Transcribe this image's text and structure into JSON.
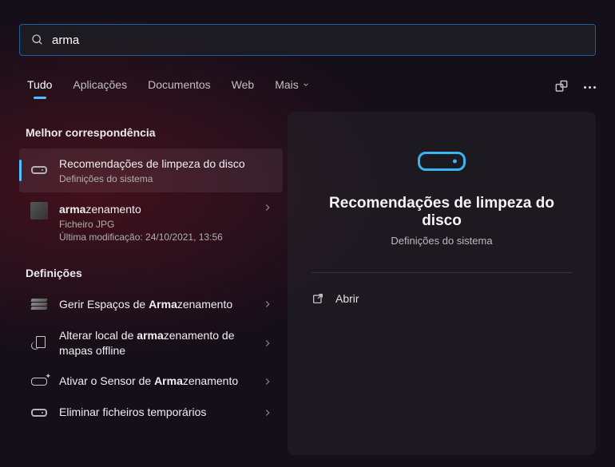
{
  "search": {
    "value": "arma",
    "placeholder": ""
  },
  "tabs": [
    {
      "label": "Tudo",
      "active": true
    },
    {
      "label": "Aplicações",
      "active": false
    },
    {
      "label": "Documentos",
      "active": false
    },
    {
      "label": "Web",
      "active": false
    },
    {
      "label": "Mais",
      "active": false,
      "more": true
    }
  ],
  "sections": {
    "best_match": {
      "heading": "Melhor correspondência",
      "items": [
        {
          "title": "Recomendações de limpeza do disco",
          "subtitle": "Definições do sistema",
          "icon": "disk-icon",
          "selected": true,
          "chevron": false
        },
        {
          "title_html": "<b>arma</b>zenamento",
          "subtitle": "Ficheiro JPG",
          "subtitle2": "Última modificação: 24/10/2021, 13:56",
          "icon": "jpg-thumb",
          "chevron": true
        }
      ]
    },
    "settings": {
      "heading": "Definições",
      "items": [
        {
          "title_html": "Gerir Espaços de <b>Arma</b>zenamento",
          "icon": "disks-stack",
          "chevron": true
        },
        {
          "title_html": "Alterar local de <b>arma</b>zenamento de mapas offline",
          "icon": "map-change",
          "chevron": true
        },
        {
          "title_html": "Ativar o Sensor de <b>Arma</b>zenamento",
          "icon": "sensor-icon",
          "chevron": true
        },
        {
          "title_html": "Eliminar ficheiros temporários",
          "icon": "disk-mini",
          "chevron": true
        }
      ]
    }
  },
  "detail": {
    "title": "Recomendações de limpeza do disco",
    "subtitle": "Definições do sistema",
    "actions": [
      {
        "label": "Abrir",
        "icon": "open-external-icon"
      }
    ]
  }
}
